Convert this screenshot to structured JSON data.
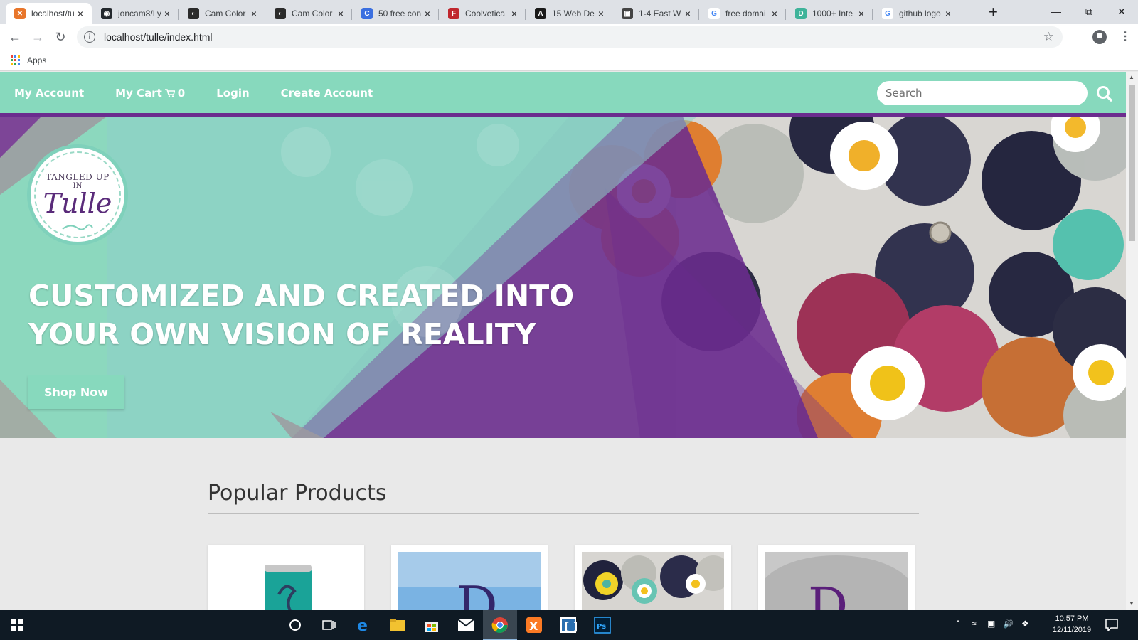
{
  "browser": {
    "tabs": [
      {
        "title": "localhost/tulle",
        "favicon_color": "#e8762b",
        "favicon_glyph": "✕",
        "active": true
      },
      {
        "title": "joncam8/Ly",
        "favicon_color": "#24292e",
        "favicon_glyph": "◉",
        "active": false
      },
      {
        "title": "Cam Color",
        "favicon_color": "#2b2b2b",
        "favicon_glyph": "◐",
        "active": false
      },
      {
        "title": "Cam Color",
        "favicon_color": "#2b2b2b",
        "favicon_glyph": "◐",
        "active": false
      },
      {
        "title": "50 free con",
        "favicon_color": "#3b6fe0",
        "favicon_glyph": "C",
        "active": false
      },
      {
        "title": "Coolvetica",
        "favicon_color": "#c0262d",
        "favicon_glyph": "F",
        "active": false
      },
      {
        "title": "15 Web De",
        "favicon_color": "#1a1a1a",
        "favicon_glyph": "A",
        "active": false
      },
      {
        "title": "1-4 East W",
        "favicon_color": "#444444",
        "favicon_glyph": "▣",
        "active": false
      },
      {
        "title": "free domai",
        "favicon_color": "#ffffff",
        "favicon_glyph": "G",
        "active": false
      },
      {
        "title": "1000+ Inte",
        "favicon_color": "#3fb39a",
        "favicon_glyph": "D",
        "active": false
      },
      {
        "title": "github logo",
        "favicon_color": "#ffffff",
        "favicon_glyph": "G",
        "active": false
      }
    ],
    "url": "localhost/tulle/index.html",
    "bookmarks_label": "Apps"
  },
  "site": {
    "nav": {
      "my_account": "My Account",
      "my_cart": "My Cart",
      "cart_count": "0",
      "login": "Login",
      "create_account": "Create Account"
    },
    "search": {
      "placeholder": "Search"
    },
    "logo": {
      "line1": "TANGLED UP",
      "line2": "IN",
      "line3": "Tulle"
    },
    "hero": {
      "headline_line1": "CUSTOMIZED AND CREATED INTO",
      "headline_line2": "YOUR OWN VISION OF REALITY",
      "cta": "Shop Now"
    },
    "popular": {
      "heading": "Popular Products"
    },
    "colors": {
      "mint": "#87d9bd",
      "purple": "#6b2c8e"
    }
  },
  "taskbar": {
    "time": "10:57 PM",
    "date": "12/11/2019"
  }
}
